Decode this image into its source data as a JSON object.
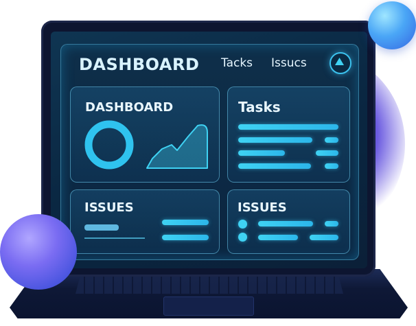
{
  "header": {
    "title": "DASHBOARD",
    "nav": [
      "Tacks",
      "Issucs"
    ],
    "up_icon": "triangle-up-icon"
  },
  "cards": {
    "dashboard": {
      "title": "DASHBOARD"
    },
    "tasks": {
      "title": "Tasks"
    },
    "issues_left": {
      "title": "ISSUES"
    },
    "issues_right": {
      "title": "ISSUES"
    }
  },
  "colors": {
    "accent": "#3fd2f3",
    "panel_bg": "#0b2540",
    "laptop": "#0d1530",
    "orb_top": "#4aa6f6",
    "orb_bottom": "#7a6cf2"
  }
}
